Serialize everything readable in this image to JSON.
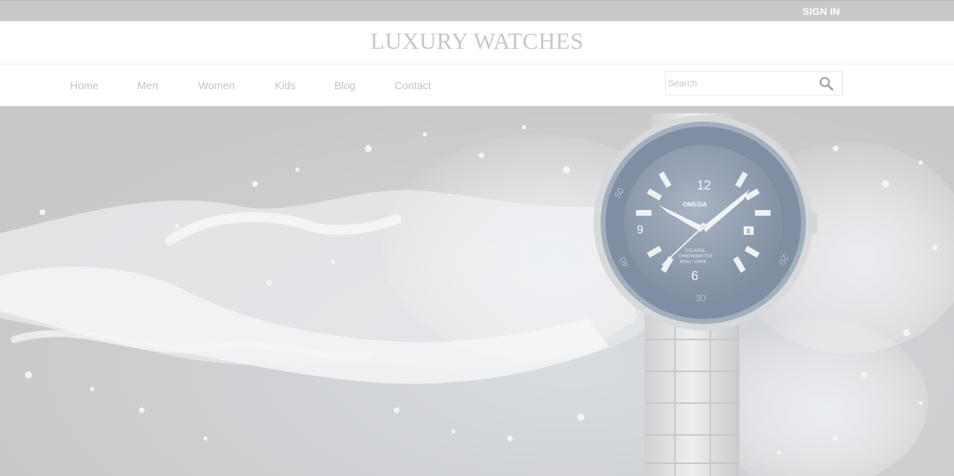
{
  "header": {
    "signin_label": "SIGN IN",
    "brand_title": "LUXURY WATCHES"
  },
  "nav": {
    "items": [
      {
        "label": "Home"
      },
      {
        "label": "Men"
      },
      {
        "label": "Women"
      },
      {
        "label": "Kids"
      },
      {
        "label": "Blog"
      },
      {
        "label": "Contact"
      }
    ]
  },
  "search": {
    "placeholder": "Search",
    "value": "",
    "icon": "search-icon"
  },
  "hero": {
    "image": "water-splash-watch-banner",
    "watch": {
      "brand_text": "OMEGA",
      "dial_numbers": [
        "12",
        "9",
        "6"
      ],
      "date_window": "8",
      "dial_text_lines": [
        "CO-AXIAL",
        "CHRONOMETER",
        "600m / 2000ft"
      ],
      "bezel_numbers": [
        "50",
        "40",
        "20",
        "30"
      ]
    }
  },
  "colors": {
    "topbar": "#c9c9c9",
    "nav_text": "#c4c4c4",
    "brand_text": "#c7c7c7",
    "dial": "#8e9aac"
  }
}
